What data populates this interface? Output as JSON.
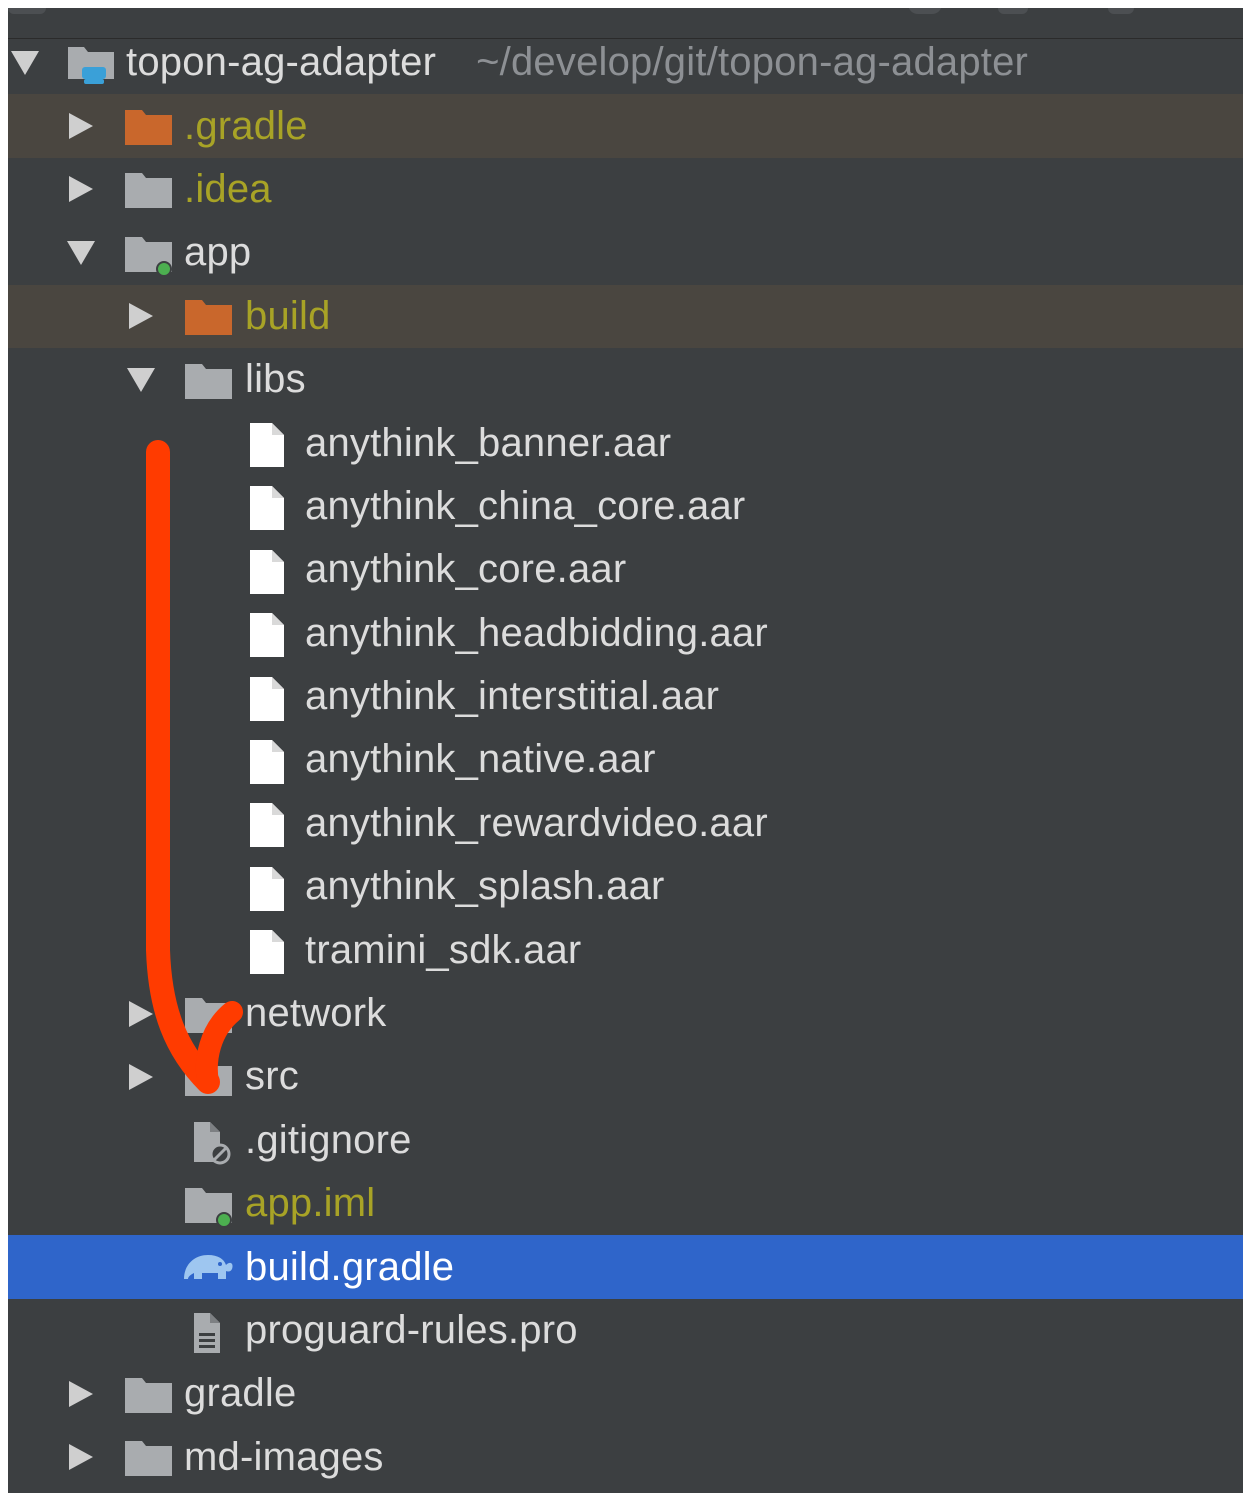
{
  "project": {
    "name": "topon-ag-adapter",
    "path": "~/develop/git/topon-ag-adapter"
  },
  "colors": {
    "panel_bg": "#3c3f41",
    "selection": "#2f65ca",
    "excluded_row": "#4a4640",
    "excluded_text": "#a8a326",
    "excluded_folder": "#c9672c",
    "folder": "#a9acaf",
    "module_dot": "#4caf50",
    "annotation_stroke": "#ff3b00"
  },
  "tree": [
    {
      "label": ".gradle",
      "icon": "folder-icon-excluded",
      "state": "collapsed"
    },
    {
      "label": ".idea",
      "icon": "folder-icon",
      "state": "collapsed"
    },
    {
      "label": "app",
      "icon": "module-folder-icon",
      "state": "expanded"
    },
    {
      "label": "build",
      "icon": "folder-icon-excluded",
      "state": "collapsed"
    },
    {
      "label": "libs",
      "icon": "folder-icon",
      "state": "expanded"
    },
    {
      "label": "anythink_banner.aar",
      "icon": "file-icon"
    },
    {
      "label": "anythink_china_core.aar",
      "icon": "file-icon"
    },
    {
      "label": "anythink_core.aar",
      "icon": "file-icon"
    },
    {
      "label": "anythink_headbidding.aar",
      "icon": "file-icon"
    },
    {
      "label": "anythink_interstitial.aar",
      "icon": "file-icon"
    },
    {
      "label": "anythink_native.aar",
      "icon": "file-icon"
    },
    {
      "label": "anythink_rewardvideo.aar",
      "icon": "file-icon"
    },
    {
      "label": "anythink_splash.aar",
      "icon": "file-icon"
    },
    {
      "label": "tramini_sdk.aar",
      "icon": "file-icon"
    },
    {
      "label": "network",
      "icon": "folder-icon",
      "state": "collapsed"
    },
    {
      "label": "src",
      "icon": "folder-icon",
      "state": "collapsed"
    },
    {
      "label": ".gitignore",
      "icon": "gitignore-file-icon"
    },
    {
      "label": "app.iml",
      "icon": "module-file-icon"
    },
    {
      "label": "build.gradle",
      "icon": "gradle-elephant-icon",
      "selected": true
    },
    {
      "label": "proguard-rules.pro",
      "icon": "text-file-icon"
    },
    {
      "label": "gradle",
      "icon": "folder-icon",
      "state": "collapsed"
    },
    {
      "label": "md-images",
      "icon": "folder-icon",
      "state": "collapsed"
    }
  ]
}
